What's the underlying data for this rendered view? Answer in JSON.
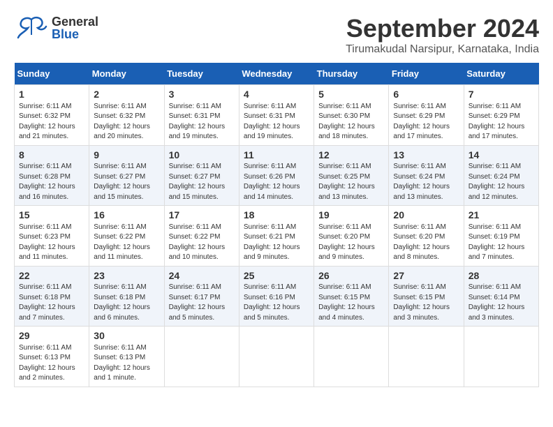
{
  "header": {
    "logo_general": "General",
    "logo_blue": "Blue",
    "month_year": "September 2024",
    "location": "Tirumakudal Narsipur, Karnataka, India"
  },
  "days_of_week": [
    "Sunday",
    "Monday",
    "Tuesday",
    "Wednesday",
    "Thursday",
    "Friday",
    "Saturday"
  ],
  "weeks": [
    [
      {
        "day": "1",
        "sunrise": "Sunrise: 6:11 AM",
        "sunset": "Sunset: 6:32 PM",
        "daylight": "Daylight: 12 hours and 21 minutes."
      },
      {
        "day": "2",
        "sunrise": "Sunrise: 6:11 AM",
        "sunset": "Sunset: 6:32 PM",
        "daylight": "Daylight: 12 hours and 20 minutes."
      },
      {
        "day": "3",
        "sunrise": "Sunrise: 6:11 AM",
        "sunset": "Sunset: 6:31 PM",
        "daylight": "Daylight: 12 hours and 19 minutes."
      },
      {
        "day": "4",
        "sunrise": "Sunrise: 6:11 AM",
        "sunset": "Sunset: 6:31 PM",
        "daylight": "Daylight: 12 hours and 19 minutes."
      },
      {
        "day": "5",
        "sunrise": "Sunrise: 6:11 AM",
        "sunset": "Sunset: 6:30 PM",
        "daylight": "Daylight: 12 hours and 18 minutes."
      },
      {
        "day": "6",
        "sunrise": "Sunrise: 6:11 AM",
        "sunset": "Sunset: 6:29 PM",
        "daylight": "Daylight: 12 hours and 17 minutes."
      },
      {
        "day": "7",
        "sunrise": "Sunrise: 6:11 AM",
        "sunset": "Sunset: 6:29 PM",
        "daylight": "Daylight: 12 hours and 17 minutes."
      }
    ],
    [
      {
        "day": "8",
        "sunrise": "Sunrise: 6:11 AM",
        "sunset": "Sunset: 6:28 PM",
        "daylight": "Daylight: 12 hours and 16 minutes."
      },
      {
        "day": "9",
        "sunrise": "Sunrise: 6:11 AM",
        "sunset": "Sunset: 6:27 PM",
        "daylight": "Daylight: 12 hours and 15 minutes."
      },
      {
        "day": "10",
        "sunrise": "Sunrise: 6:11 AM",
        "sunset": "Sunset: 6:27 PM",
        "daylight": "Daylight: 12 hours and 15 minutes."
      },
      {
        "day": "11",
        "sunrise": "Sunrise: 6:11 AM",
        "sunset": "Sunset: 6:26 PM",
        "daylight": "Daylight: 12 hours and 14 minutes."
      },
      {
        "day": "12",
        "sunrise": "Sunrise: 6:11 AM",
        "sunset": "Sunset: 6:25 PM",
        "daylight": "Daylight: 12 hours and 13 minutes."
      },
      {
        "day": "13",
        "sunrise": "Sunrise: 6:11 AM",
        "sunset": "Sunset: 6:24 PM",
        "daylight": "Daylight: 12 hours and 13 minutes."
      },
      {
        "day": "14",
        "sunrise": "Sunrise: 6:11 AM",
        "sunset": "Sunset: 6:24 PM",
        "daylight": "Daylight: 12 hours and 12 minutes."
      }
    ],
    [
      {
        "day": "15",
        "sunrise": "Sunrise: 6:11 AM",
        "sunset": "Sunset: 6:23 PM",
        "daylight": "Daylight: 12 hours and 11 minutes."
      },
      {
        "day": "16",
        "sunrise": "Sunrise: 6:11 AM",
        "sunset": "Sunset: 6:22 PM",
        "daylight": "Daylight: 12 hours and 11 minutes."
      },
      {
        "day": "17",
        "sunrise": "Sunrise: 6:11 AM",
        "sunset": "Sunset: 6:22 PM",
        "daylight": "Daylight: 12 hours and 10 minutes."
      },
      {
        "day": "18",
        "sunrise": "Sunrise: 6:11 AM",
        "sunset": "Sunset: 6:21 PM",
        "daylight": "Daylight: 12 hours and 9 minutes."
      },
      {
        "day": "19",
        "sunrise": "Sunrise: 6:11 AM",
        "sunset": "Sunset: 6:20 PM",
        "daylight": "Daylight: 12 hours and 9 minutes."
      },
      {
        "day": "20",
        "sunrise": "Sunrise: 6:11 AM",
        "sunset": "Sunset: 6:20 PM",
        "daylight": "Daylight: 12 hours and 8 minutes."
      },
      {
        "day": "21",
        "sunrise": "Sunrise: 6:11 AM",
        "sunset": "Sunset: 6:19 PM",
        "daylight": "Daylight: 12 hours and 7 minutes."
      }
    ],
    [
      {
        "day": "22",
        "sunrise": "Sunrise: 6:11 AM",
        "sunset": "Sunset: 6:18 PM",
        "daylight": "Daylight: 12 hours and 7 minutes."
      },
      {
        "day": "23",
        "sunrise": "Sunrise: 6:11 AM",
        "sunset": "Sunset: 6:18 PM",
        "daylight": "Daylight: 12 hours and 6 minutes."
      },
      {
        "day": "24",
        "sunrise": "Sunrise: 6:11 AM",
        "sunset": "Sunset: 6:17 PM",
        "daylight": "Daylight: 12 hours and 5 minutes."
      },
      {
        "day": "25",
        "sunrise": "Sunrise: 6:11 AM",
        "sunset": "Sunset: 6:16 PM",
        "daylight": "Daylight: 12 hours and 5 minutes."
      },
      {
        "day": "26",
        "sunrise": "Sunrise: 6:11 AM",
        "sunset": "Sunset: 6:15 PM",
        "daylight": "Daylight: 12 hours and 4 minutes."
      },
      {
        "day": "27",
        "sunrise": "Sunrise: 6:11 AM",
        "sunset": "Sunset: 6:15 PM",
        "daylight": "Daylight: 12 hours and 3 minutes."
      },
      {
        "day": "28",
        "sunrise": "Sunrise: 6:11 AM",
        "sunset": "Sunset: 6:14 PM",
        "daylight": "Daylight: 12 hours and 3 minutes."
      }
    ],
    [
      {
        "day": "29",
        "sunrise": "Sunrise: 6:11 AM",
        "sunset": "Sunset: 6:13 PM",
        "daylight": "Daylight: 12 hours and 2 minutes."
      },
      {
        "day": "30",
        "sunrise": "Sunrise: 6:11 AM",
        "sunset": "Sunset: 6:13 PM",
        "daylight": "Daylight: 12 hours and 1 minute."
      },
      null,
      null,
      null,
      null,
      null
    ]
  ]
}
